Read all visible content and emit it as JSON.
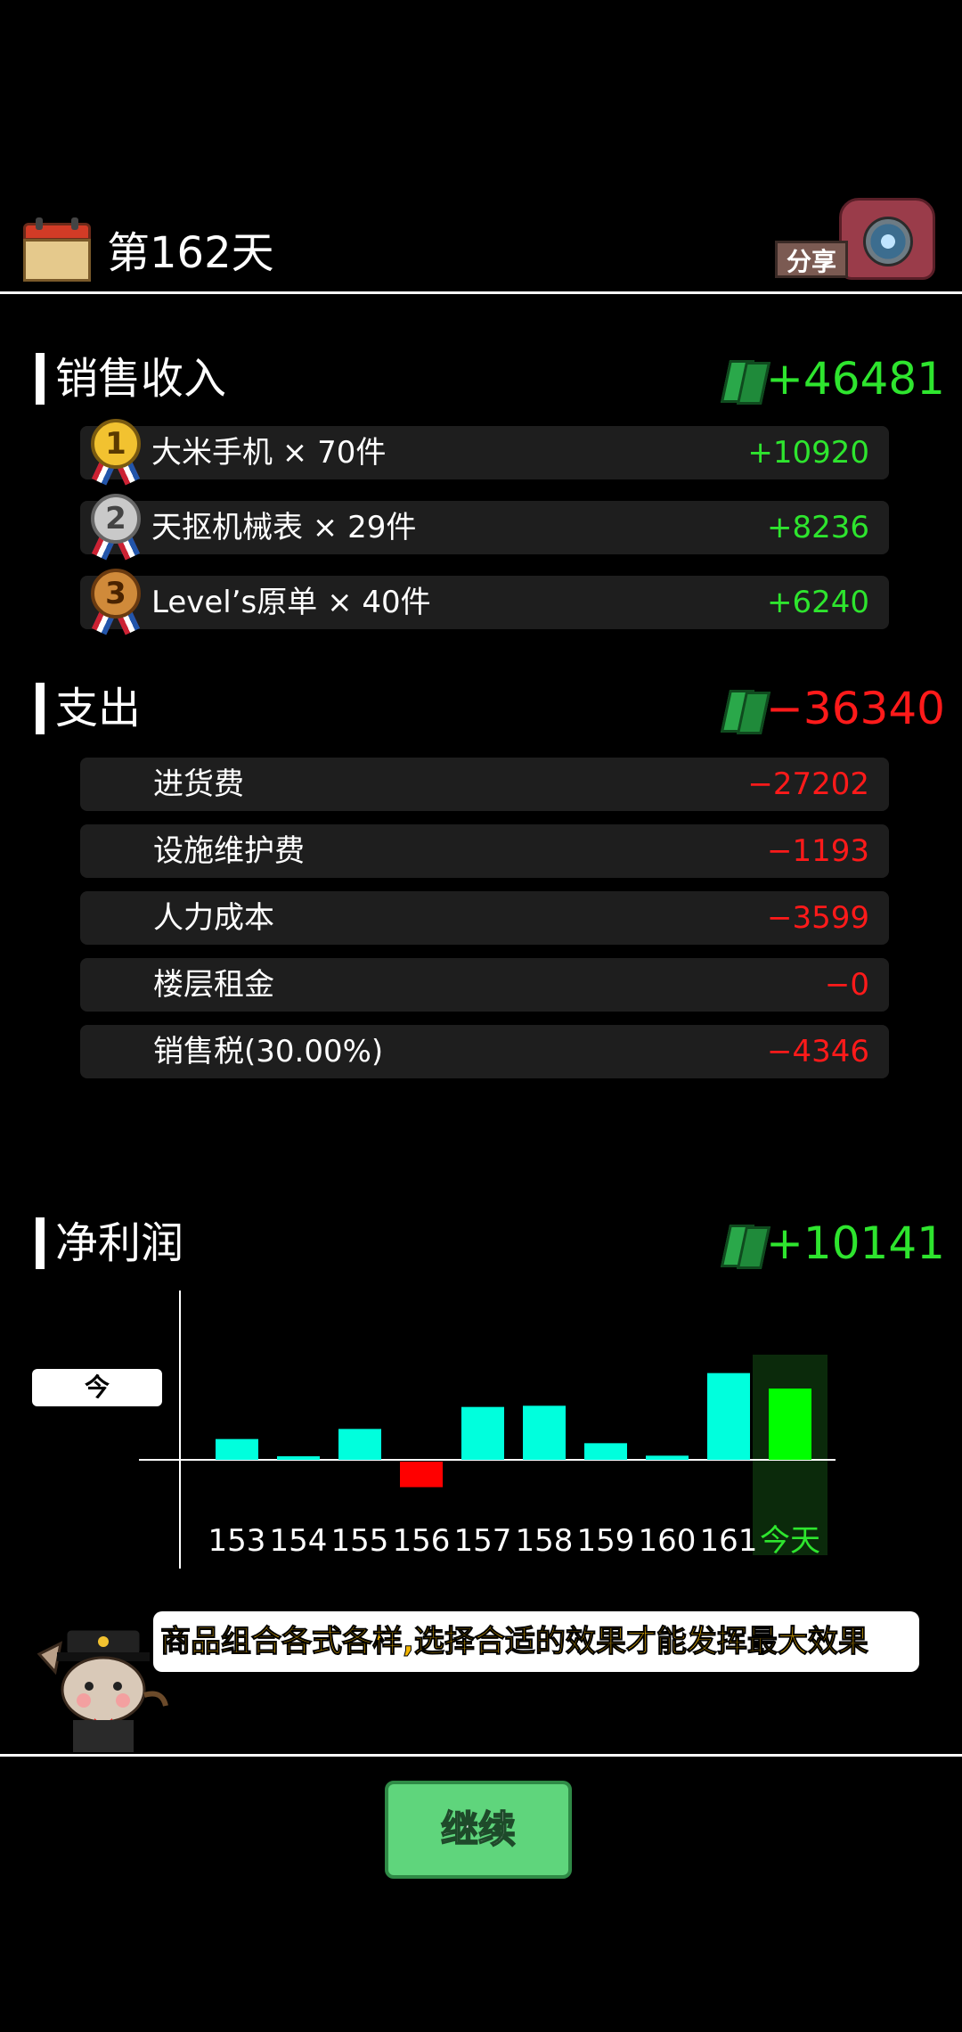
{
  "header": {
    "day_title": "第162天",
    "share_label": "分享"
  },
  "income": {
    "title": "销售收入",
    "total": "+46481",
    "items": [
      {
        "rank": "1",
        "label": "大米手机 × 70件",
        "value": "+10920"
      },
      {
        "rank": "2",
        "label": "天抠机械表 × 29件",
        "value": "+8236"
      },
      {
        "rank": "3",
        "label": "Level’s原单 × 40件",
        "value": "+6240"
      }
    ]
  },
  "expense": {
    "title": "支出",
    "total": "−36340",
    "items": [
      {
        "label": "进货费",
        "value": "−27202"
      },
      {
        "label": "设施维护费",
        "value": "−1193"
      },
      {
        "label": "人力成本",
        "value": "−3599"
      },
      {
        "label": "楼层租金",
        "value": "−0"
      },
      {
        "label": "销售税(30.00%)",
        "value": "−4346"
      }
    ]
  },
  "profit": {
    "title": "净利润",
    "total": "+10141",
    "today_tag": "今天:10141"
  },
  "chart_data": {
    "type": "bar",
    "categories": [
      "153",
      "154",
      "155",
      "156",
      "157",
      "158",
      "159",
      "160",
      "161",
      "今天"
    ],
    "values": [
      3500,
      600,
      5200,
      -4300,
      8900,
      9100,
      2800,
      700,
      14600,
      12000
    ],
    "colors": {
      "positive": "#00ffdd",
      "negative": "#ff0000",
      "today": "#00ff00",
      "today_highlight": "#0b2a0b",
      "today_label": "#2ee52e"
    }
  },
  "tip": {
    "text": "商品组合各式各样,选择合适的效果才能发挥最大效果"
  },
  "continue_button": {
    "label": "继续"
  }
}
